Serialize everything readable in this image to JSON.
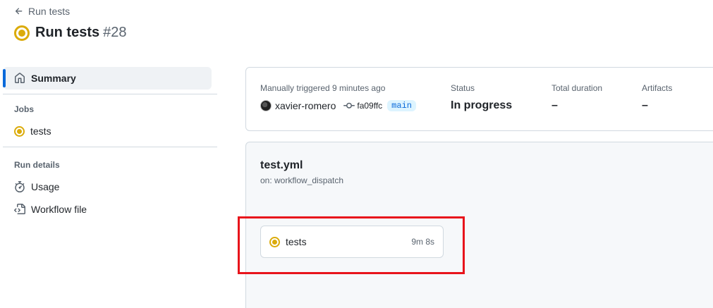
{
  "header": {
    "back_label": "Run tests",
    "title": "Run tests",
    "run_number": "#28"
  },
  "sidebar": {
    "summary_label": "Summary",
    "jobs_heading": "Jobs",
    "jobs": [
      {
        "label": "tests"
      }
    ],
    "run_details_heading": "Run details",
    "details": [
      {
        "label": "Usage"
      },
      {
        "label": "Workflow file"
      }
    ]
  },
  "summary": {
    "trigger_text": "Manually triggered 9 minutes ago",
    "actor": "xavier-romero",
    "commit": "fa09ffc",
    "branch": "main",
    "status_label": "Status",
    "status_value": "In progress",
    "duration_label": "Total duration",
    "duration_value": "–",
    "artifacts_label": "Artifacts",
    "artifacts_value": "–"
  },
  "workflow": {
    "file_name": "test.yml",
    "trigger": "on: workflow_dispatch",
    "job": {
      "name": "tests",
      "duration": "9m 8s"
    }
  },
  "colors": {
    "in_progress": "#dbab0a",
    "accent": "#0969da",
    "highlight": "#e8141b"
  }
}
